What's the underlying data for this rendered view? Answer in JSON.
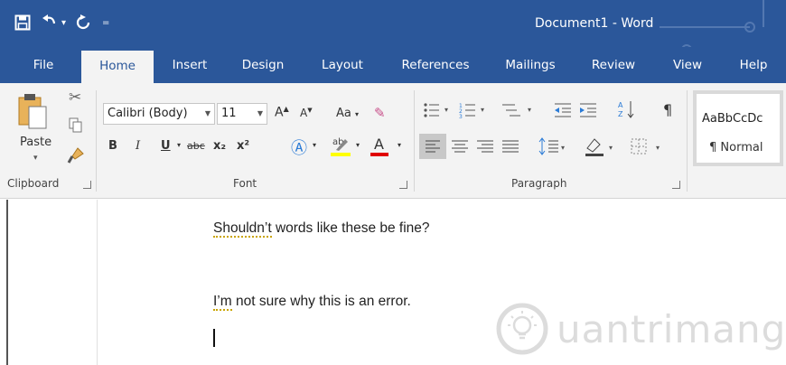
{
  "window": {
    "title": "Document1  -  Word"
  },
  "tabs": [
    {
      "label": "File"
    },
    {
      "label": "Home"
    },
    {
      "label": "Insert"
    },
    {
      "label": "Design"
    },
    {
      "label": "Layout"
    },
    {
      "label": "References"
    },
    {
      "label": "Mailings"
    },
    {
      "label": "Review"
    },
    {
      "label": "View"
    },
    {
      "label": "Help"
    }
  ],
  "clipboard": {
    "paste_label": "Paste",
    "group_label": "Clipboard"
  },
  "font": {
    "name_value": "Calibri (Body)",
    "size_value": "11",
    "change_case_label": "Aa",
    "bold": "B",
    "italic": "I",
    "underline": "U",
    "strike": "abc",
    "subscript": "x₂",
    "superscript": "x²",
    "group_label": "Font"
  },
  "paragraph": {
    "group_label": "Paragraph",
    "pilcrow": "¶"
  },
  "styles": {
    "sample_text": "AaBbCcDc",
    "normal_label": "¶ Normal"
  },
  "document": {
    "line1_prefix": "",
    "line1_word": "Shouldn’t",
    "line1_rest": " words like these be fine?",
    "line2_word": "I’m",
    "line2_rest": " not sure why this is an error."
  },
  "watermark": {
    "text": "uantrimang"
  },
  "colors": {
    "ribbon_blue": "#2b579a",
    "highlight_yellow": "#ffff00",
    "font_red": "#e00000"
  }
}
